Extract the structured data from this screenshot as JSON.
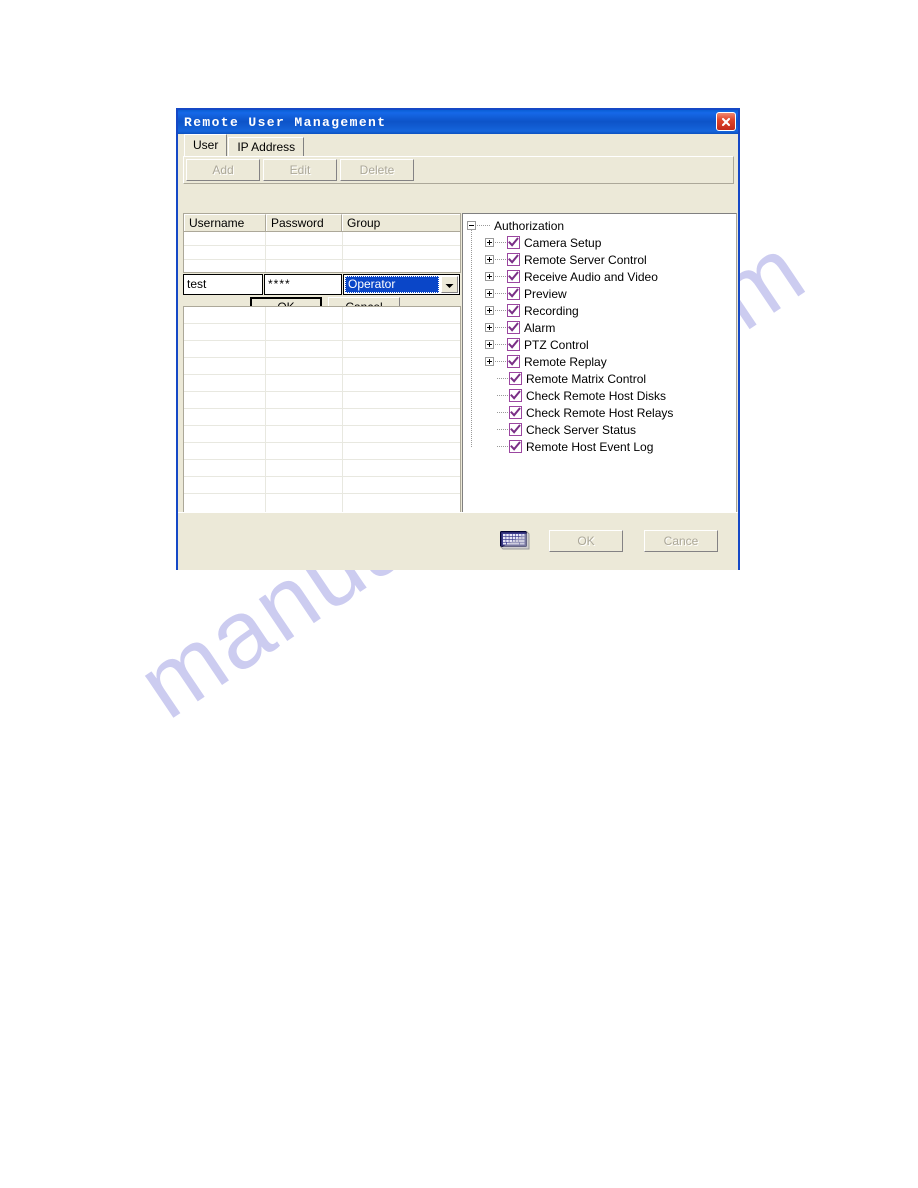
{
  "watermark": {
    "text": "manualshive.com"
  },
  "dialog": {
    "title": "Remote User Management",
    "close_icon": "close-icon",
    "tabs": [
      {
        "label": "User",
        "active": true
      },
      {
        "label": "IP Address",
        "active": false
      }
    ],
    "toolbar": {
      "add_label": "Add",
      "edit_label": "Edit",
      "delete_label": "Delete"
    },
    "grid": {
      "columns": [
        "Username",
        "Password",
        "Group"
      ],
      "rows": []
    },
    "edit_row": {
      "username_value": "test",
      "password_value": "****",
      "group_value": "Operator",
      "group_options": [
        "Operator"
      ],
      "dropdown_icon": "chevron-down-icon"
    },
    "inline_buttons": {
      "ok_label": "OK",
      "cancel_label": "Cancel"
    },
    "list": {
      "rows": []
    },
    "tree": {
      "root_label": "Authorization",
      "items": [
        {
          "label": "Camera Setup",
          "checked": true,
          "expandable": true
        },
        {
          "label": "Remote Server Control",
          "checked": true,
          "expandable": true
        },
        {
          "label": "Receive Audio and Video",
          "checked": true,
          "expandable": true
        },
        {
          "label": "Preview",
          "checked": true,
          "expandable": true
        },
        {
          "label": "Recording",
          "checked": true,
          "expandable": true
        },
        {
          "label": "Alarm",
          "checked": true,
          "expandable": true
        },
        {
          "label": "PTZ Control",
          "checked": true,
          "expandable": true
        },
        {
          "label": "Remote Replay",
          "checked": true,
          "expandable": true
        },
        {
          "label": "Remote Matrix Control",
          "checked": true,
          "expandable": false
        },
        {
          "label": "Check Remote Host Disks",
          "checked": true,
          "expandable": false
        },
        {
          "label": "Check Remote Host Relays",
          "checked": true,
          "expandable": false
        },
        {
          "label": "Check Server Status",
          "checked": true,
          "expandable": false
        },
        {
          "label": "Remote Host Event Log",
          "checked": true,
          "expandable": false
        }
      ]
    },
    "footer": {
      "keyboard_icon": "keyboard-icon",
      "ok_label": "OK",
      "cancel_label": "Cance"
    },
    "colors": {
      "titlebar": "#0d53c8",
      "face": "#ece9d8",
      "checkbox": "#9b46a0",
      "selection": "#0a46c8",
      "frame": "#1548c6",
      "watermark": "#ccccf0"
    }
  }
}
